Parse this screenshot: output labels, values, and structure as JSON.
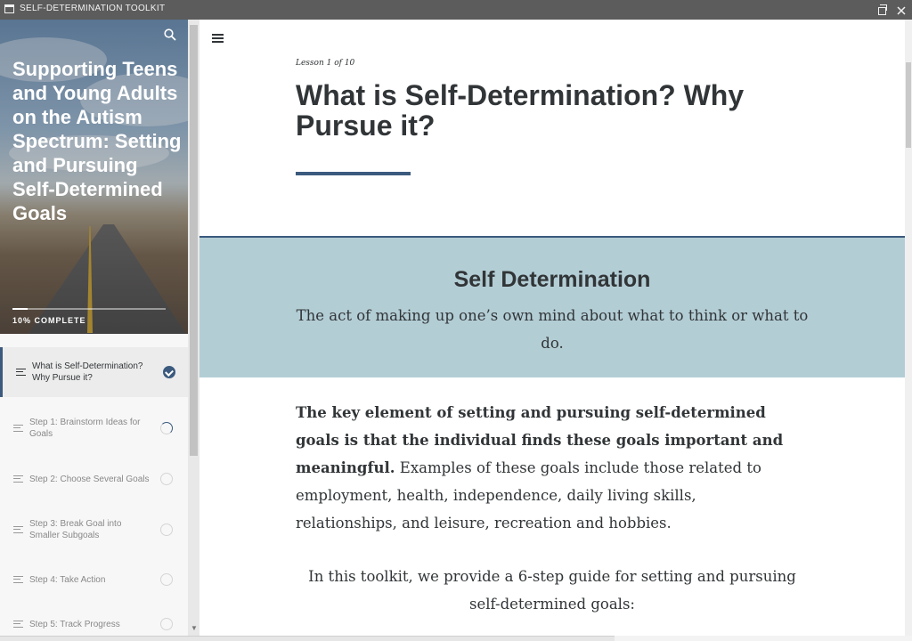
{
  "window": {
    "title": "SELF-DETERMINATION TOOLKIT",
    "restore_label": "",
    "close_label": ""
  },
  "sidebar": {
    "course_title": "Supporting Teens and Young Adults on the Autism Spectrum: Setting and Pursuing Self-Determined Goals",
    "progress_percent": 10,
    "progress_label": "10% COMPLETE",
    "lessons": [
      {
        "label": "What is Self-Determination? Why Pursue it?",
        "status": "complete",
        "active": true
      },
      {
        "label": "Step 1: Brainstorm Ideas for Goals",
        "status": "in-progress",
        "active": false
      },
      {
        "label": "Step 2: Choose Several Goals",
        "status": "not-started",
        "active": false
      },
      {
        "label": "Step 3: Break Goal into Smaller Subgoals",
        "status": "not-started",
        "active": false
      },
      {
        "label": "Step 4: Take Action",
        "status": "not-started",
        "active": false
      },
      {
        "label": "Step 5: Track Progress",
        "status": "not-started",
        "active": false
      }
    ]
  },
  "main": {
    "lesson_count": "Lesson 1 of 10",
    "lesson_title": "What is Self-Determination? Why Pursue it?",
    "callout": {
      "title": "Self Determination",
      "text": "The act of making up one’s own mind about what to think or what to do."
    },
    "paragraph1_bold": "The key element of setting and pursuing self-determined goals is that the individual finds these goals important and meaningful.",
    "paragraph1_rest": " Examples of these goals include those related to employment, health, independence, daily living skills, relationships, and leisure, recreation and hobbies.",
    "paragraph2": "In this toolkit, we provide a 6-step guide for setting and pursuing self-determined goals:"
  },
  "colors": {
    "accent": "#3b5a7e",
    "callout_bg": "#b3cdd5",
    "titlebar_bg": "#5c5c5c"
  }
}
